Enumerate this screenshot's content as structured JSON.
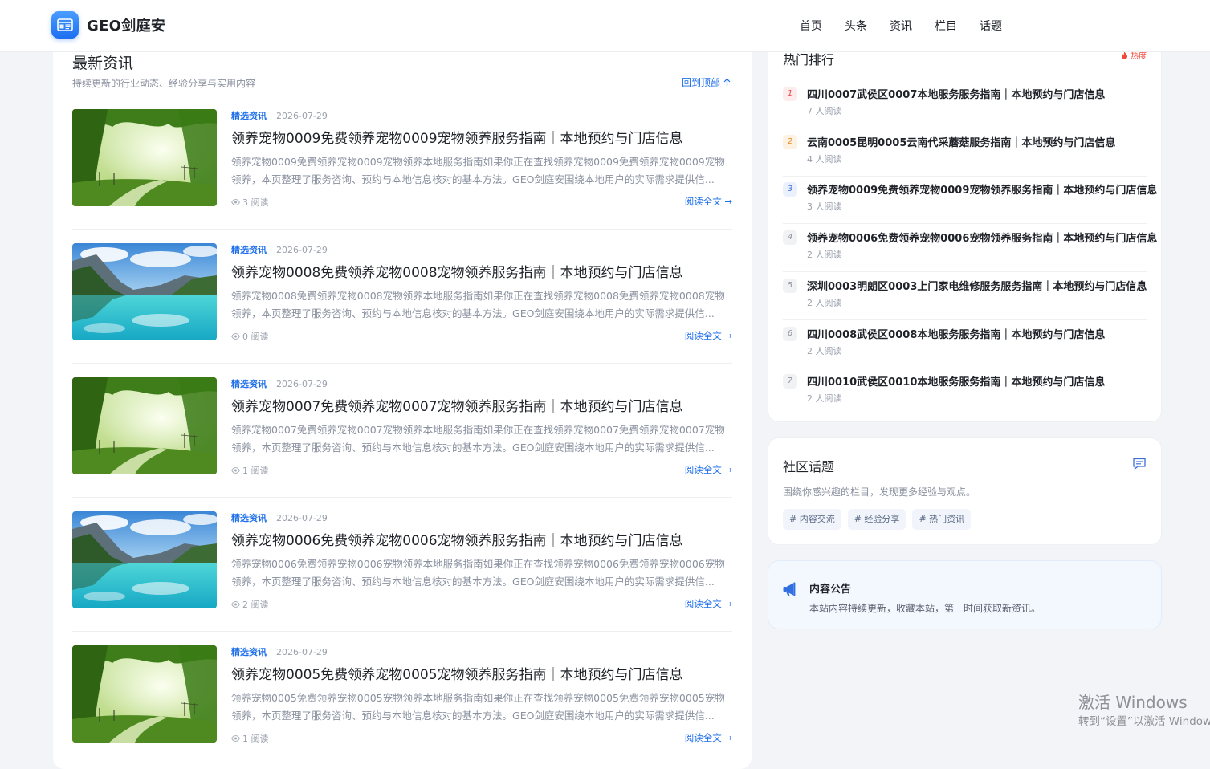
{
  "header": {
    "brand": "GEO剑庭安",
    "nav": [
      "首页",
      "头条",
      "资讯",
      "栏目",
      "话题"
    ]
  },
  "latest": {
    "title": "最新资讯",
    "subtitle": "持续更新的行业动态、经验分享与实用内容",
    "back_to_top": "回到顶部",
    "articles": [
      {
        "category": "精选资讯",
        "date": "2026-07-29",
        "title": "领养宠物0009免费领养宠物0009宠物领养服务指南｜本地预约与门店信息",
        "excerpt": "领养宠物0009免费领养宠物0009宠物领养本地服务指南如果你正在查找领养宠物0009免费领养宠物0009宠物领养，本页整理了服务咨询、预约与本地信息核对的基本方法。GEO剑庭安围绕本地用户的实际需求提供信...",
        "reads": "3 阅读",
        "read_more": "阅读全文 →",
        "image": "forest"
      },
      {
        "category": "精选资讯",
        "date": "2026-07-29",
        "title": "领养宠物0008免费领养宠物0008宠物领养服务指南｜本地预约与门店信息",
        "excerpt": "领养宠物0008免费领养宠物0008宠物领养本地服务指南如果你正在查找领养宠物0008免费领养宠物0008宠物领养，本页整理了服务咨询、预约与本地信息核对的基本方法。GEO剑庭安围绕本地用户的实际需求提供信...",
        "reads": "0 阅读",
        "read_more": "阅读全文 →",
        "image": "lake"
      },
      {
        "category": "精选资讯",
        "date": "2026-07-29",
        "title": "领养宠物0007免费领养宠物0007宠物领养服务指南｜本地预约与门店信息",
        "excerpt": "领养宠物0007免费领养宠物0007宠物领养本地服务指南如果你正在查找领养宠物0007免费领养宠物0007宠物领养，本页整理了服务咨询、预约与本地信息核对的基本方法。GEO剑庭安围绕本地用户的实际需求提供信...",
        "reads": "1 阅读",
        "read_more": "阅读全文 →",
        "image": "forest"
      },
      {
        "category": "精选资讯",
        "date": "2026-07-29",
        "title": "领养宠物0006免费领养宠物0006宠物领养服务指南｜本地预约与门店信息",
        "excerpt": "领养宠物0006免费领养宠物0006宠物领养本地服务指南如果你正在查找领养宠物0006免费领养宠物0006宠物领养，本页整理了服务咨询、预约与本地信息核对的基本方法。GEO剑庭安围绕本地用户的实际需求提供信...",
        "reads": "2 阅读",
        "read_more": "阅读全文 →",
        "image": "lake"
      },
      {
        "category": "精选资讯",
        "date": "2026-07-29",
        "title": "领养宠物0005免费领养宠物0005宠物领养服务指南｜本地预约与门店信息",
        "excerpt": "领养宠物0005免费领养宠物0005宠物领养本地服务指南如果你正在查找领养宠物0005免费领养宠物0005宠物领养，本页整理了服务咨询、预约与本地信息核对的基本方法。GEO剑庭安围绕本地用户的实际需求提供信...",
        "reads": "1 阅读",
        "read_more": "阅读全文 →",
        "image": "forest"
      }
    ]
  },
  "hot": {
    "title": "热门排行",
    "badge": "热度",
    "items": [
      {
        "rank": "1",
        "title": "四川0007武侯区0007本地服务服务指南｜本地预约与门店信息",
        "reads": "7 人阅读"
      },
      {
        "rank": "2",
        "title": "云南0005昆明0005云南代采蘑菇服务指南｜本地预约与门店信息",
        "reads": "4 人阅读"
      },
      {
        "rank": "3",
        "title": "领养宠物0009免费领养宠物0009宠物领养服务指南｜本地预约与门店信息",
        "reads": "3 人阅读"
      },
      {
        "rank": "4",
        "title": "领养宠物0006免费领养宠物0006宠物领养服务指南｜本地预约与门店信息",
        "reads": "2 人阅读"
      },
      {
        "rank": "5",
        "title": "深圳0003明朗区0003上门家电维修服务服务指南｜本地预约与门店信息",
        "reads": "2 人阅读"
      },
      {
        "rank": "6",
        "title": "四川0008武侯区0008本地服务服务指南｜本地预约与门店信息",
        "reads": "2 人阅读"
      },
      {
        "rank": "7",
        "title": "四川0010武侯区0010本地服务服务指南｜本地预约与门店信息",
        "reads": "2 人阅读"
      }
    ],
    "rank_colors": [
      {
        "bg": "#fdecec",
        "fg": "#e5484d"
      },
      {
        "bg": "#fdf1e1",
        "fg": "#e08a1e"
      },
      {
        "bg": "#eaf1fd",
        "fg": "#3a6fd8"
      },
      {
        "bg": "#f1f2f4",
        "fg": "#8a919f"
      }
    ]
  },
  "topics": {
    "title": "社区话题",
    "subtitle": "围绕你感兴趣的栏目，发现更多经验与观点。",
    "tags": [
      "# 内容交流",
      "# 经验分享",
      "# 热门资讯"
    ]
  },
  "notice": {
    "title": "内容公告",
    "text": "本站内容持续更新，收藏本站，第一时间获取新资讯。"
  },
  "watermark": {
    "title": "激活 Windows",
    "subtitle": "转到“设置”以激活 Windows。"
  },
  "colors": {
    "accent": "#1f6feb",
    "hot_red": "#f04a3a"
  }
}
